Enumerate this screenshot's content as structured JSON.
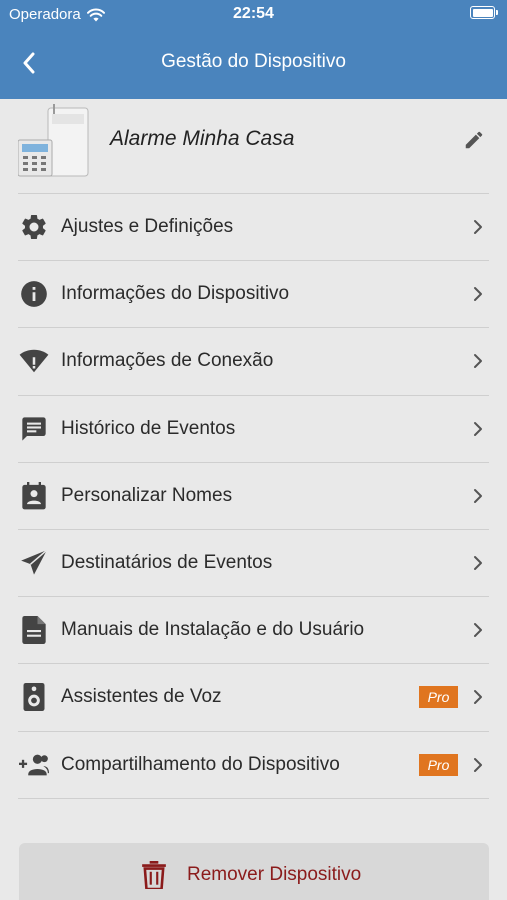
{
  "status_bar": {
    "carrier": "Operadora",
    "time": "22:54"
  },
  "navbar": {
    "title": "Gestão do Dispositivo",
    "back_icon": "chevron-left-icon"
  },
  "device": {
    "name": "Alarme Minha Casa",
    "edit_icon": "pencil-icon"
  },
  "menu": {
    "items": [
      {
        "label": "Ajustes e Definições",
        "icon": "gear-icon"
      },
      {
        "label": "Informações do Dispositivo",
        "icon": "info-icon"
      },
      {
        "label": "Informações de Conexão",
        "icon": "wifi-signal-icon"
      },
      {
        "label": "Histórico de Eventos",
        "icon": "message-icon"
      },
      {
        "label": "Personalizar Nomes",
        "icon": "contact-card-icon"
      },
      {
        "label": "Destinatários de Eventos",
        "icon": "send-icon"
      },
      {
        "label": "Manuais de Instalação e do Usuário",
        "icon": "document-icon"
      },
      {
        "label": "Assistentes de Voz",
        "icon": "speaker-icon",
        "badge": "Pro"
      },
      {
        "label": "Compartilhamento do Dispositivo",
        "icon": "add-people-icon",
        "badge": "Pro"
      }
    ]
  },
  "remove_button": {
    "label": "Remover Dispositivo",
    "icon": "trash-icon"
  },
  "colors": {
    "header": "#4a84bd",
    "background": "#e9e9e9",
    "pro_badge": "#e0751f",
    "danger": "#8b1b1b"
  }
}
